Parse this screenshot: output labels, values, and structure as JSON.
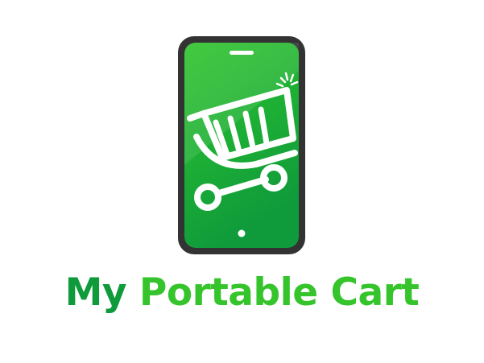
{
  "logo": {
    "name_part1": "My",
    "name_part2": "Portable Cart",
    "brand_dark_green": "#0f9a3b",
    "brand_light_green": "#35c42b",
    "phone_frame_color": "#333333",
    "icon_semantic": "shopping-cart-in-smartphone-icon"
  }
}
